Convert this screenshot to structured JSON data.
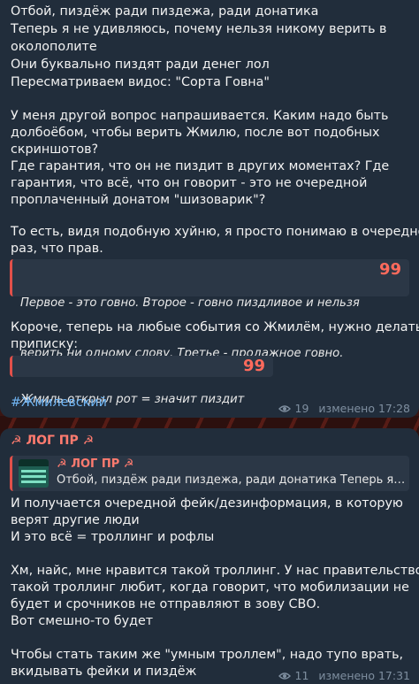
{
  "msg1": {
    "lines_a": [
      "Отбой, пиздёж ради пиздежа, ради донатика",
      "Теперь я не удивляюсь, почему нельзя никому верить в",
      "околополите",
      "Они буквально пиздят ради денег лол",
      "Пересматриваем видос: \"Сорта Говна\""
    ],
    "lines_b": [
      "У меня другой вопрос напрашивается. Каким надо быть",
      "долбоёбом, чтобы верить Жмилю, после вот подобных",
      "скриншотов?",
      "Где гарантия, что он не пиздит в других моментах? Где",
      "гарантия, что всё, что он говорит - это не очередной",
      "проплаченный донатом \"шизоварик\"?"
    ],
    "lines_c": [
      "То есть, видя подобную хуйню, я просто понимаю в очередной",
      "раз, что прав."
    ],
    "quote1": [
      "Первое - это говно. Второе - говно пиздливое и нельзя",
      "верить ни одному слову. Третье - продажное говно."
    ],
    "lines_d": [
      "Короче, теперь на любые события со Жмилём, нужно делать",
      "приписку:"
    ],
    "quote2": "Жмиль открыл рот = значит пиздит",
    "quote_mark": "99",
    "hashtag": "#Жмилевский",
    "views": "19",
    "edited": "изменено 17:28"
  },
  "msg2": {
    "sender": "ЛОГ ПР",
    "sender_sym": "☭",
    "reply_name": "ЛОГ ПР",
    "reply_text": "Отбой, пиздёж ради пиздежа, ради донатика Теперь я не удивляюсь",
    "lines_a": [
      "И получается очередной фейк/дезинформация, в которую",
      "верят другие люди",
      "И это всё = троллинг и рофлы"
    ],
    "lines_b": [
      "Хм, найс, мне нравится такой троллинг. У нас правительство",
      "такой троллинг любит, когда говорит, что мобилизации не",
      "будет и срочников не отправляют в зову СВО.",
      "Вот смешно-то будет"
    ],
    "lines_c": [
      "Чтобы стать таким же \"умным троллем\", надо тупо врать,",
      "вкидывать фейки и пиздёж"
    ],
    "views": "11",
    "edited": "изменено 17:31"
  },
  "colors": {
    "accent": "#e2504a",
    "link": "#71b6f5",
    "bubble": "#212d3b",
    "name": "#ff7b6f"
  },
  "icons": [
    "eye-icon",
    "quote-icon",
    "hammer-sickle-icon"
  ]
}
